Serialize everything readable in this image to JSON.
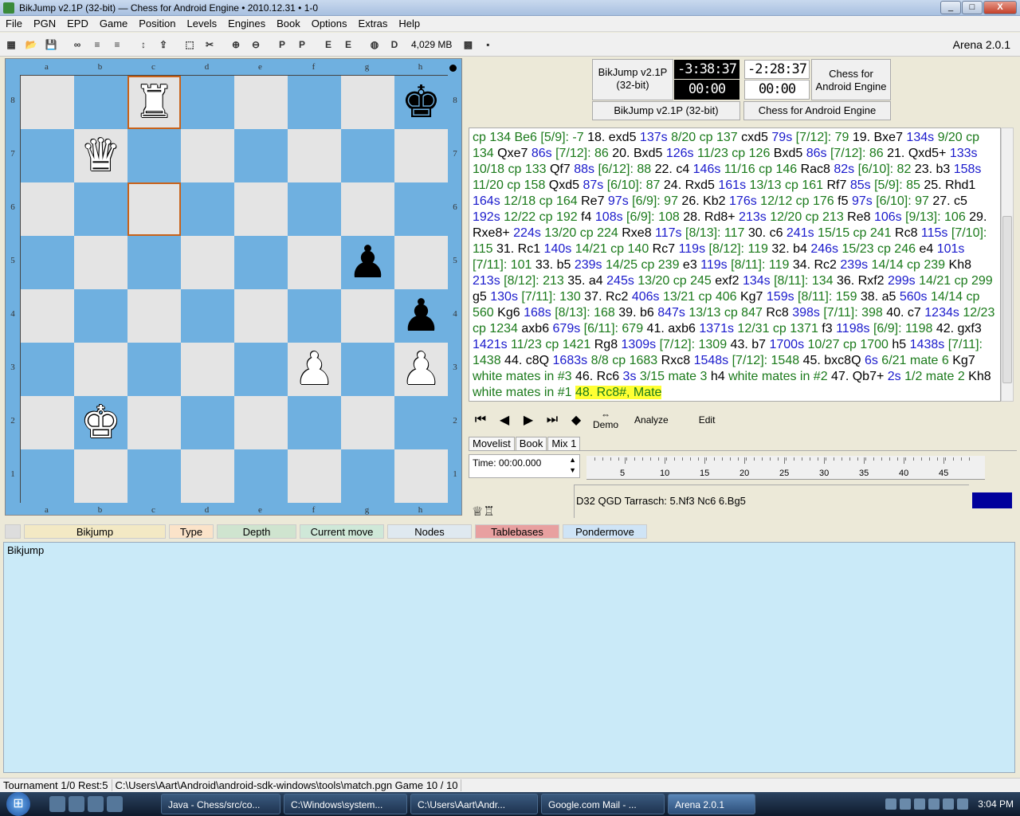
{
  "window": {
    "title": "BikJump v2.1P (32-bit) — Chess for Android Engine  •  2010.12.31  •  1-0",
    "min": "_",
    "max": "□",
    "close": "X"
  },
  "menu": [
    "File",
    "PGN",
    "EPD",
    "Game",
    "Position",
    "Levels",
    "Engines",
    "Book",
    "Options",
    "Extras",
    "Help"
  ],
  "toolbar": {
    "memory": "4,029 MB",
    "app": "Arena 2.0.1"
  },
  "board": {
    "files": [
      "a",
      "b",
      "c",
      "d",
      "e",
      "f",
      "g",
      "h"
    ],
    "ranks": [
      "8",
      "7",
      "6",
      "5",
      "4",
      "3",
      "2",
      "1"
    ],
    "pieces": {
      "c8": "♜w",
      "h8": "♚b",
      "b7": "♛w",
      "g5": "♟b",
      "h4": "♟b",
      "f3": "♟w",
      "h3": "♟w",
      "b2": "♚w"
    },
    "highlight": [
      "c8",
      "c6"
    ]
  },
  "players": {
    "white": "BikJump v2.1P\n(32-bit)",
    "black": "Chess for\nAndroid Engine",
    "white_clock": "-3:38:37",
    "white_move": "00:00",
    "black_clock": "-2:28:37",
    "black_move": "00:00",
    "white_name": "BikJump v2.1P (32-bit)",
    "black_name": "Chess for Android Engine"
  },
  "movelist": [
    [
      "g",
      "cp 134 Be6 [5/9]: -7 "
    ],
    [
      "k",
      "18. exd5 "
    ],
    [
      "b",
      "137s "
    ],
    [
      "g",
      "8/20 cp 137 "
    ],
    [
      "k",
      "cxd5 "
    ],
    [
      "b",
      "79s "
    ],
    [
      "g",
      "[7/12]: 79 "
    ],
    [
      "k",
      "19. Bxe7 "
    ],
    [
      "b",
      "134s "
    ],
    [
      "g",
      " 9/20 cp 134 "
    ],
    [
      "k",
      "Qxe7 "
    ],
    [
      "b",
      "86s "
    ],
    [
      "g",
      "[7/12]: 86 "
    ],
    [
      "k",
      "20. Bxd5 "
    ],
    [
      "b",
      "126s "
    ],
    [
      "g",
      "11/23 cp 126 "
    ],
    [
      "k",
      "Bxd5 "
    ],
    [
      "b",
      "86s "
    ],
    [
      "g",
      "[7/12]: 86 "
    ],
    [
      "k",
      "21. Qxd5+ "
    ],
    [
      "b",
      "133s "
    ],
    [
      "g",
      "10/18 cp 133 "
    ],
    [
      "k",
      "Qf7 "
    ],
    [
      "b",
      "88s "
    ],
    [
      "g",
      "[6/12]: 88 "
    ],
    [
      "k",
      "22. c4 "
    ],
    [
      "b",
      "146s "
    ],
    [
      "g",
      "11/16 cp 146 "
    ],
    [
      "k",
      "Rac8 "
    ],
    [
      "b",
      "82s "
    ],
    [
      "g",
      "[6/10]: 82 "
    ],
    [
      "k",
      "23. b3 "
    ],
    [
      "b",
      "158s "
    ],
    [
      "g",
      "11/20 cp 158 "
    ],
    [
      "k",
      "Qxd5 "
    ],
    [
      "b",
      "87s "
    ],
    [
      "g",
      "[6/10]: 87 "
    ],
    [
      "k",
      "24. Rxd5 "
    ],
    [
      "b",
      "161s "
    ],
    [
      "g",
      "13/13 cp 161 "
    ],
    [
      "k",
      "Rf7 "
    ],
    [
      "b",
      "85s "
    ],
    [
      "g",
      "[5/9]: 85 "
    ],
    [
      "k",
      "25. Rhd1 "
    ],
    [
      "b",
      "164s "
    ],
    [
      "g",
      "12/18 cp 164 "
    ],
    [
      "k",
      "Re7 "
    ],
    [
      "b",
      "97s "
    ],
    [
      "g",
      "[6/9]: 97 "
    ],
    [
      "k",
      "26. Kb2 "
    ],
    [
      "b",
      "176s "
    ],
    [
      "g",
      "12/12 cp 176 "
    ],
    [
      "k",
      "f5 "
    ],
    [
      "b",
      "97s "
    ],
    [
      "g",
      "[6/10]: 97 "
    ],
    [
      "k",
      "27. c5 "
    ],
    [
      "b",
      "192s "
    ],
    [
      "g",
      "12/22 cp 192 "
    ],
    [
      "k",
      "f4 "
    ],
    [
      "b",
      "108s "
    ],
    [
      "g",
      "[6/9]: 108 "
    ],
    [
      "k",
      "28. Rd8+ "
    ],
    [
      "b",
      "213s "
    ],
    [
      "g",
      "12/20 cp 213 "
    ],
    [
      "k",
      "Re8 "
    ],
    [
      "b",
      "106s "
    ],
    [
      "g",
      "[9/13]: 106 "
    ],
    [
      "k",
      "29. Rxe8+ "
    ],
    [
      "b",
      "224s "
    ],
    [
      "g",
      "13/20 cp 224 "
    ],
    [
      "k",
      "Rxe8 "
    ],
    [
      "b",
      "117s "
    ],
    [
      "g",
      "[8/13]: 117 "
    ],
    [
      "k",
      "30. c6 "
    ],
    [
      "b",
      "241s "
    ],
    [
      "g",
      "15/15 cp 241 "
    ],
    [
      "k",
      "Rc8 "
    ],
    [
      "b",
      "115s "
    ],
    [
      "g",
      "[7/10]: 115 "
    ],
    [
      "k",
      "31. Rc1 "
    ],
    [
      "b",
      "140s "
    ],
    [
      "g",
      "14/21 cp 140 "
    ],
    [
      "k",
      "Rc7 "
    ],
    [
      "b",
      "119s "
    ],
    [
      "g",
      "[8/12]: 119 "
    ],
    [
      "k",
      "32. b4 "
    ],
    [
      "b",
      "246s "
    ],
    [
      "g",
      "15/23 cp 246 "
    ],
    [
      "k",
      "e4 "
    ],
    [
      "b",
      "101s "
    ],
    [
      "g",
      " [7/11]: 101 "
    ],
    [
      "k",
      "33. b5 "
    ],
    [
      "b",
      "239s "
    ],
    [
      "g",
      "14/25 cp 239 "
    ],
    [
      "k",
      "e3 "
    ],
    [
      "b",
      "119s "
    ],
    [
      "g",
      "[8/11]: 119 "
    ],
    [
      "k",
      "34. Rc2 "
    ],
    [
      "b",
      "239s "
    ],
    [
      "g",
      "14/14 cp 239 "
    ],
    [
      "k",
      "Kh8 "
    ],
    [
      "b",
      "213s "
    ],
    [
      "g",
      "[8/12]: 213 "
    ],
    [
      "k",
      "35. a4 "
    ],
    [
      "b",
      "245s "
    ],
    [
      "g",
      "13/20 cp 245 "
    ],
    [
      "k",
      "exf2 "
    ],
    [
      "b",
      "134s "
    ],
    [
      "g",
      "[8/11]: 134 "
    ],
    [
      "k",
      "36. Rxf2 "
    ],
    [
      "b",
      "299s "
    ],
    [
      "g",
      "14/21 cp 299 "
    ],
    [
      "k",
      "g5 "
    ],
    [
      "b",
      "130s "
    ],
    [
      "g",
      "[7/11]: 130 "
    ],
    [
      "k",
      "37. Rc2 "
    ],
    [
      "b",
      "406s "
    ],
    [
      "g",
      "13/21 cp 406 "
    ],
    [
      "k",
      "Kg7 "
    ],
    [
      "b",
      "159s "
    ],
    [
      "g",
      "[8/11]: 159 "
    ],
    [
      "k",
      "38. a5 "
    ],
    [
      "b",
      "560s "
    ],
    [
      "g",
      "14/14 cp 560 "
    ],
    [
      "k",
      "Kg6 "
    ],
    [
      "b",
      "168s "
    ],
    [
      "g",
      "[8/13]: 168 "
    ],
    [
      "k",
      "39. b6 "
    ],
    [
      "b",
      "847s "
    ],
    [
      "g",
      "13/13 cp 847 "
    ],
    [
      "k",
      "Rc8 "
    ],
    [
      "b",
      "398s "
    ],
    [
      "g",
      "[7/11]: 398 "
    ],
    [
      "k",
      "40. c7 "
    ],
    [
      "b",
      "1234s "
    ],
    [
      "g",
      " 12/23 cp 1234 "
    ],
    [
      "k",
      "axb6 "
    ],
    [
      "b",
      "679s "
    ],
    [
      "g",
      "[6/11]: 679 "
    ],
    [
      "k",
      "41. axb6 "
    ],
    [
      "b",
      "1371s "
    ],
    [
      "g",
      "12/31 cp 1371 "
    ],
    [
      "k",
      "f3 "
    ],
    [
      "b",
      "1198s "
    ],
    [
      "g",
      "[6/9]: 1198 "
    ],
    [
      "k",
      "42. gxf3 "
    ],
    [
      "b",
      "1421s "
    ],
    [
      "g",
      "11/23 cp 1421 "
    ],
    [
      "k",
      "Rg8 "
    ],
    [
      "b",
      "1309s "
    ],
    [
      "g",
      "[7/12]: 1309 "
    ],
    [
      "k",
      "43. b7 "
    ],
    [
      "b",
      "1700s "
    ],
    [
      "g",
      "10/27 cp 1700 "
    ],
    [
      "k",
      "h5 "
    ],
    [
      "b",
      "1438s "
    ],
    [
      "g",
      " [7/11]: 1438 "
    ],
    [
      "k",
      "44. c8Q "
    ],
    [
      "b",
      "1683s "
    ],
    [
      "g",
      "8/8 cp 1683 "
    ],
    [
      "k",
      "Rxc8 "
    ],
    [
      "b",
      "1548s "
    ],
    [
      "g",
      "[7/12]: 1548 "
    ],
    [
      "k",
      "45. bxc8Q "
    ],
    [
      "b",
      "6s "
    ],
    [
      "g",
      "6/21 mate 6 "
    ],
    [
      "k",
      "Kg7 "
    ],
    [
      "g",
      "white mates in #3 "
    ],
    [
      "k",
      "46. Rc6 "
    ],
    [
      "b",
      "3s "
    ],
    [
      "g",
      "3/15 mate 3 "
    ],
    [
      "k",
      "h4 "
    ],
    [
      "g",
      "white mates in #2 "
    ],
    [
      "k",
      "47. Qb7+ "
    ],
    [
      "b",
      "2s "
    ],
    [
      "g",
      "1/2 mate 2 "
    ],
    [
      "k",
      "Kh8 "
    ],
    [
      "g",
      "white mates in #1 "
    ],
    [
      "m",
      "48. Rc8#, Mate"
    ]
  ],
  "nav": {
    "demo": "Demo",
    "analyze": "Analyze",
    "edit": "Edit"
  },
  "tabs": [
    "Movelist",
    "Book",
    "Mix 1"
  ],
  "time_label": "Time: 00:00.000",
  "ruler": [
    "5",
    "10",
    "15",
    "20",
    "25",
    "30",
    "35",
    "40",
    "45"
  ],
  "eco": "D32   QGD Tarrasch: 5.Nf3 Nc6 6.Bg5",
  "engine_cols": [
    {
      "label": "Bikjump",
      "bg": "#f3e9c4",
      "w": 178
    },
    {
      "label": "Type",
      "bg": "#fbe3c9",
      "w": 56
    },
    {
      "label": "Depth",
      "bg": "#cfe4cf",
      "w": 100
    },
    {
      "label": "Current move",
      "bg": "#cfe8d8",
      "w": 106
    },
    {
      "label": "Nodes",
      "bg": "#dfe9f0",
      "w": 106
    },
    {
      "label": "Tablebases",
      "bg": "#e8a0a0",
      "w": 106
    },
    {
      "label": "Pondermove",
      "bg": "#cfe4f6",
      "w": 106
    }
  ],
  "engine_output": "Bikjump",
  "status": {
    "tournament": "Tournament 1/0 Rest:5",
    "path": "C:\\Users\\Aart\\Android\\android-sdk-windows\\tools\\match.pgn  Game 10 / 10"
  },
  "taskbar": {
    "tasks": [
      "Java - Chess/src/co...",
      "C:\\Windows\\system...",
      "C:\\Users\\Aart\\Andr...",
      "Google.com Mail - ...",
      "Arena 2.0.1"
    ],
    "time": "3:04 PM"
  }
}
